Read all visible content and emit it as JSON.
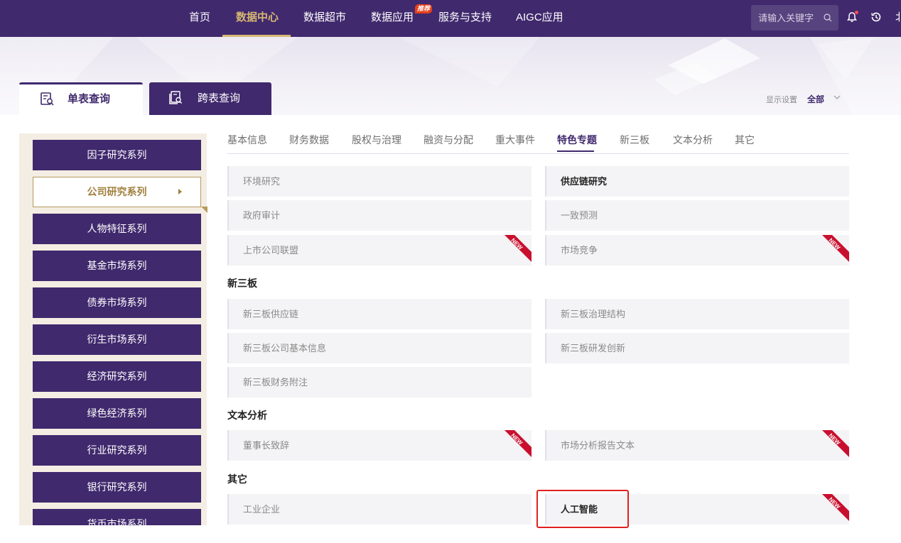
{
  "nav": {
    "items": [
      "首页",
      "数据中心",
      "数据超市",
      "数据应用",
      "服务与支持",
      "AIGC应用"
    ],
    "active": "数据中心",
    "hot_badge": "推荐",
    "search_placeholder": "请输入关键字",
    "cut_text": "北"
  },
  "query_tabs": {
    "single": "单表查询",
    "cross": "跨表查询"
  },
  "display_settings": {
    "label": "显示设置",
    "value": "全部"
  },
  "sidebar": {
    "items": [
      "因子研究系列",
      "公司研究系列",
      "人物特征系列",
      "基金市场系列",
      "债券市场系列",
      "衍生市场系列",
      "经济研究系列",
      "绿色经济系列",
      "行业研究系列",
      "银行研究系列",
      "货币市场系列"
    ],
    "active": "公司研究系列"
  },
  "subtabs": {
    "items": [
      "基本信息",
      "财务数据",
      "股权与治理",
      "融资与分配",
      "重大事件",
      "特色专题",
      "新三板",
      "文本分析",
      "其它"
    ],
    "active": "特色专题"
  },
  "sections": {
    "special": {
      "cards": [
        "环境研究",
        "供应链研究",
        "政府审计",
        "一致预测",
        "上市公司联盟",
        "市场竞争"
      ]
    },
    "neeq": {
      "title": "新三板",
      "cards": [
        "新三板供应链",
        "新三板治理结构",
        "新三板公司基本信息",
        "新三板研发创新",
        "新三板财务附注"
      ]
    },
    "text": {
      "title": "文本分析",
      "cards": [
        "董事长致辞",
        "市场分析报告文本"
      ]
    },
    "other": {
      "title": "其它",
      "cards": [
        "工业企业",
        "人工智能"
      ]
    }
  },
  "new_badge": "NEW",
  "colors": {
    "primary": "#40296d",
    "gold": "#d8b772",
    "new_badge": "#c8102e",
    "highlight": "#e02020"
  }
}
